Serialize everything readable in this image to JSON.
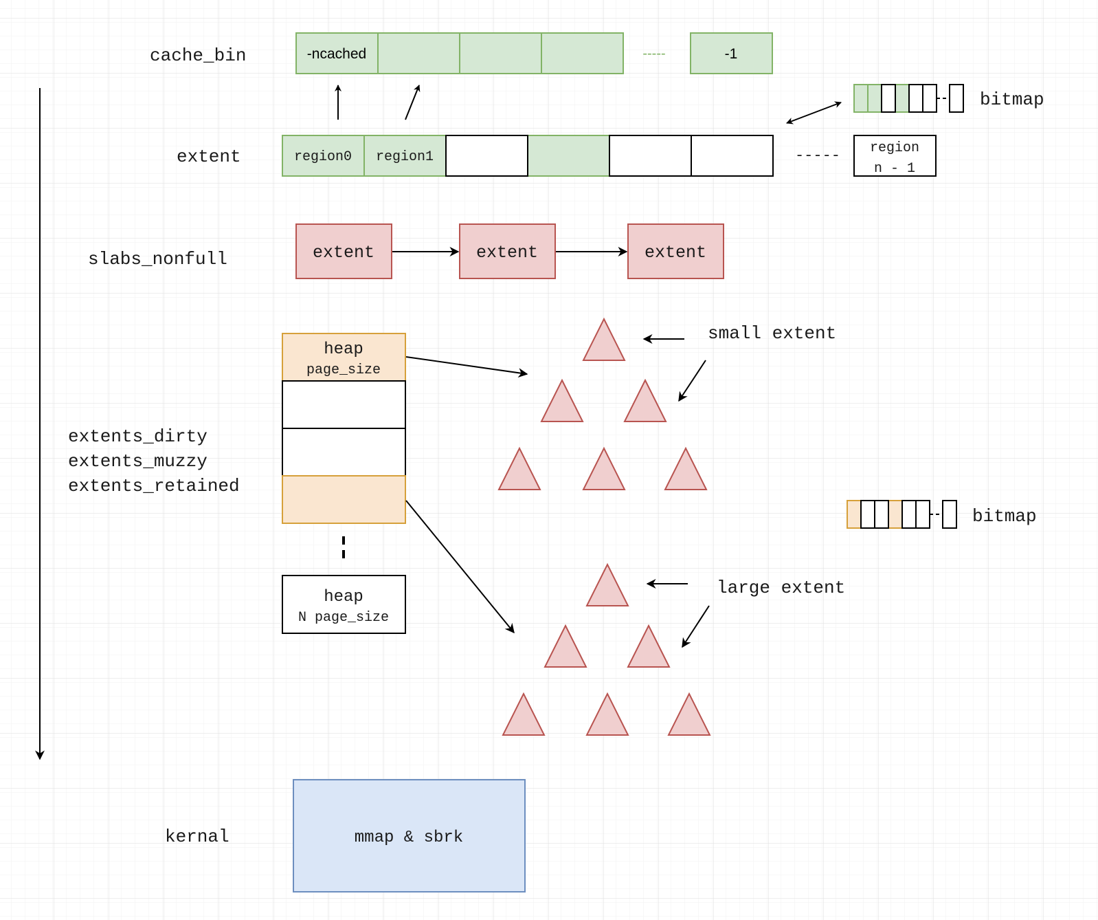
{
  "diagram": {
    "theme_colors": {
      "green_fill": "#d5e8d4",
      "green_stroke": "#82b366",
      "red_fill": "#f0cfcf",
      "red_stroke": "#b85450",
      "orange_fill": "#fae6d0",
      "orange_stroke": "#d6a03a",
      "blue_fill": "#dae6f7",
      "blue_stroke": "#6c8ebf",
      "line": "#000000",
      "grid_minor": "#f3f3f3",
      "grid_major": "#e0e0e0"
    },
    "row_labels": {
      "cache_bin": "cache_bin",
      "extent": "extent",
      "slabs_nonfull": "slabs_nonfull",
      "extents_dirty": "extents_dirty",
      "extents_muzzy": "extents_muzzy",
      "extents_retained": "extents_retained",
      "kernal": "kernal"
    },
    "cache_bin": {
      "cells": [
        "-ncached",
        "",
        "",
        ""
      ],
      "ellipsis": "-----",
      "last_cell": "-1"
    },
    "extent_row": {
      "cells": [
        {
          "label": "region0",
          "state": "used"
        },
        {
          "label": "region1",
          "state": "used"
        },
        {
          "label": "",
          "state": "free"
        },
        {
          "label": "",
          "state": "used"
        },
        {
          "label": "",
          "state": "free"
        },
        {
          "label": "",
          "state": "free"
        }
      ],
      "ellipsis": "-----",
      "last_cell_line1": "region",
      "last_cell_line2": "n - 1"
    },
    "bitmap_top": {
      "label": "bitmap",
      "bits": [
        "used",
        "used",
        "free",
        "used",
        "free",
        "free"
      ],
      "last_bit": "free"
    },
    "slabs_nonfull": {
      "nodes": [
        "extent",
        "extent",
        "extent"
      ]
    },
    "heap_stack": {
      "first_line1": "heap",
      "first_line2": "page_size",
      "cells": [
        "used",
        "free",
        "free",
        "used"
      ],
      "last_line1": "heap",
      "last_line2": "N page_size"
    },
    "small_extent": {
      "label": "small extent",
      "triangle_rows": [
        1,
        2,
        3
      ]
    },
    "large_extent": {
      "label": "large extent",
      "triangle_rows": [
        1,
        2,
        3
      ]
    },
    "bitmap_mid": {
      "label": "bitmap",
      "bits": [
        "used",
        "free",
        "free",
        "used",
        "free",
        "free"
      ],
      "last_bit": "free"
    },
    "kernal_box": {
      "label": "mmap & sbrk"
    }
  }
}
